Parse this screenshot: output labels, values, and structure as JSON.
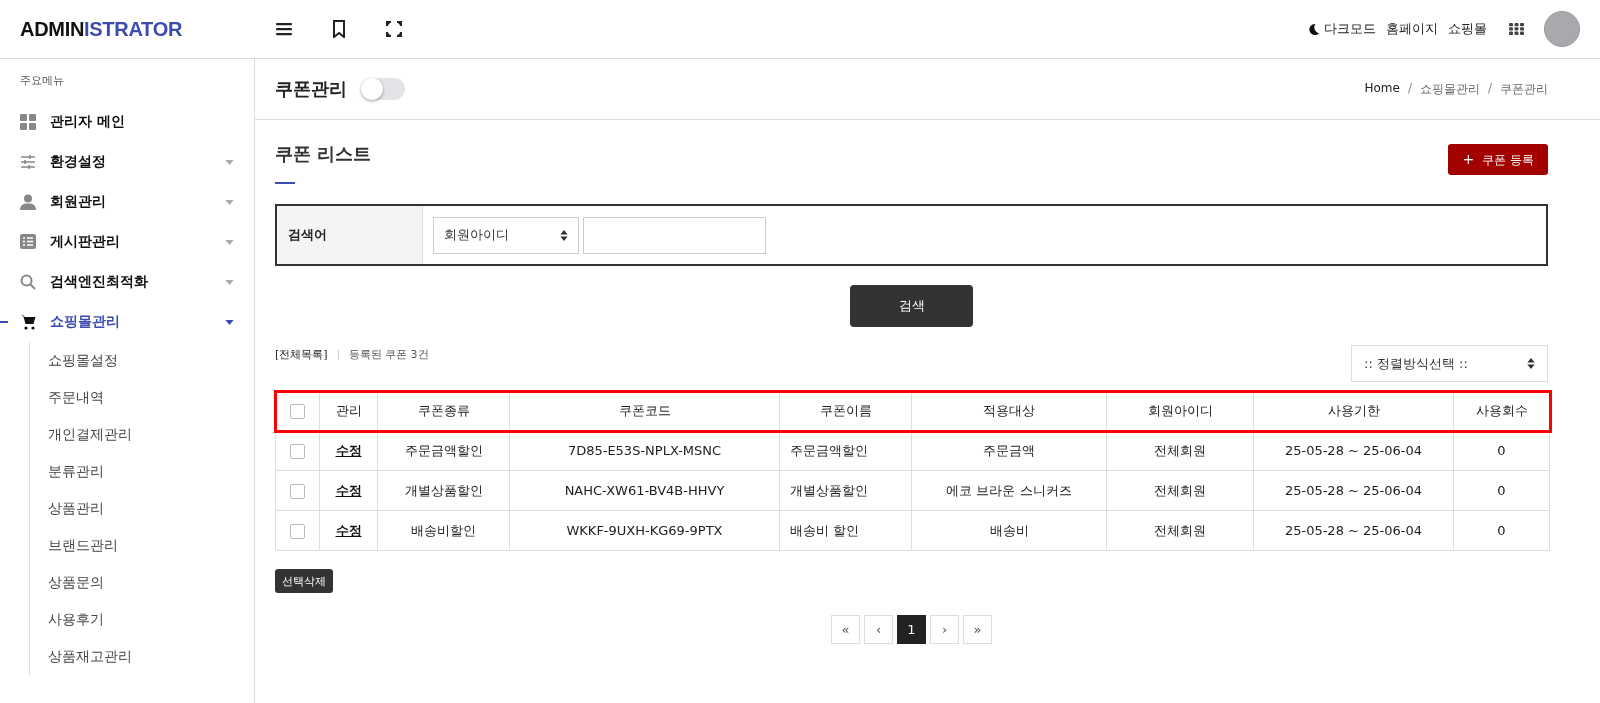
{
  "header": {
    "logo": {
      "dark_part": "ADMIN",
      "accent_part": "ISTRATOR"
    },
    "links": [
      "다크모드",
      "홈페이지",
      "쇼핑몰"
    ]
  },
  "sidebar": {
    "heading": "주요메뉴",
    "items": [
      {
        "label": "관리자 메인",
        "has_children": false,
        "selected": false
      },
      {
        "label": "환경설정",
        "has_children": true,
        "expanded": false,
        "selected": false
      },
      {
        "label": "회원관리",
        "has_children": true,
        "expanded": false,
        "selected": false
      },
      {
        "label": "게시판관리",
        "has_children": true,
        "expanded": false,
        "selected": false
      },
      {
        "label": "검색엔진최적화",
        "has_children": true,
        "expanded": false,
        "selected": false
      },
      {
        "label": "쇼핑몰관리",
        "has_children": true,
        "expanded": true,
        "selected": true,
        "children": [
          {
            "label": "쇼핑몰설정"
          },
          {
            "label": "주문내역"
          },
          {
            "label": "개인결제관리"
          },
          {
            "label": "분류관리"
          },
          {
            "label": "상품관리"
          },
          {
            "label": "브랜드관리"
          },
          {
            "label": "상품문의"
          },
          {
            "label": "사용후기"
          },
          {
            "label": "상품재고관리"
          }
        ]
      }
    ]
  },
  "page": {
    "title": "쿠폰관리",
    "toggle_on": false,
    "breadcrumb": [
      "Home",
      "쇼핑몰관리",
      "쿠폰관리"
    ],
    "breadcrumb_separator": "/"
  },
  "section": {
    "title": "쿠폰 리스트",
    "add_button": "+",
    "add_label": "쿠폰 등록"
  },
  "search": {
    "label": "검색어",
    "select_value": "회원아이디",
    "button": "검색"
  },
  "summary": {
    "all_link": "[전체목록]",
    "count_text": "등록된 쿠폰 3건",
    "sort_select": ":: 정렬방식선택 ::"
  },
  "table": {
    "header_highlighted": true,
    "header_checked": false,
    "columns": [
      "관리",
      "쿠폰종류",
      "쿠폰코드",
      "쿠폰이름",
      "적용대상",
      "회원아이디",
      "사용기한",
      "사용회수"
    ],
    "rows": [
      {
        "checked": false,
        "cells": [
          "수정",
          "주문금액할인",
          "7D85-E53S-NPLX-MSNC",
          "주문금액할인",
          "주문금액",
          "전체회원",
          "25-05-28 ~ 25-06-04",
          "0"
        ]
      },
      {
        "checked": false,
        "cells": [
          "수정",
          "개별상품할인",
          "NAHC-XW61-BV4B-HHVY",
          "개별상품할인",
          "에코 브라운 스니커즈",
          "전체회원",
          "25-05-28 ~ 25-06-04",
          "0"
        ]
      },
      {
        "checked": false,
        "cells": [
          "수정",
          "배송비할인",
          "WKKF-9UXH-KG69-9PTX",
          "배송비 할인",
          "배송비",
          "전체회원",
          "25-05-28 ~ 25-06-04",
          "0"
        ]
      }
    ]
  },
  "delete_button": "선택삭제",
  "pagination": [
    {
      "label": "«",
      "selected": false
    },
    {
      "label": "‹",
      "selected": false
    },
    {
      "label": "1",
      "selected": true
    },
    {
      "label": "›",
      "selected": false
    },
    {
      "label": "»",
      "selected": false
    }
  ]
}
